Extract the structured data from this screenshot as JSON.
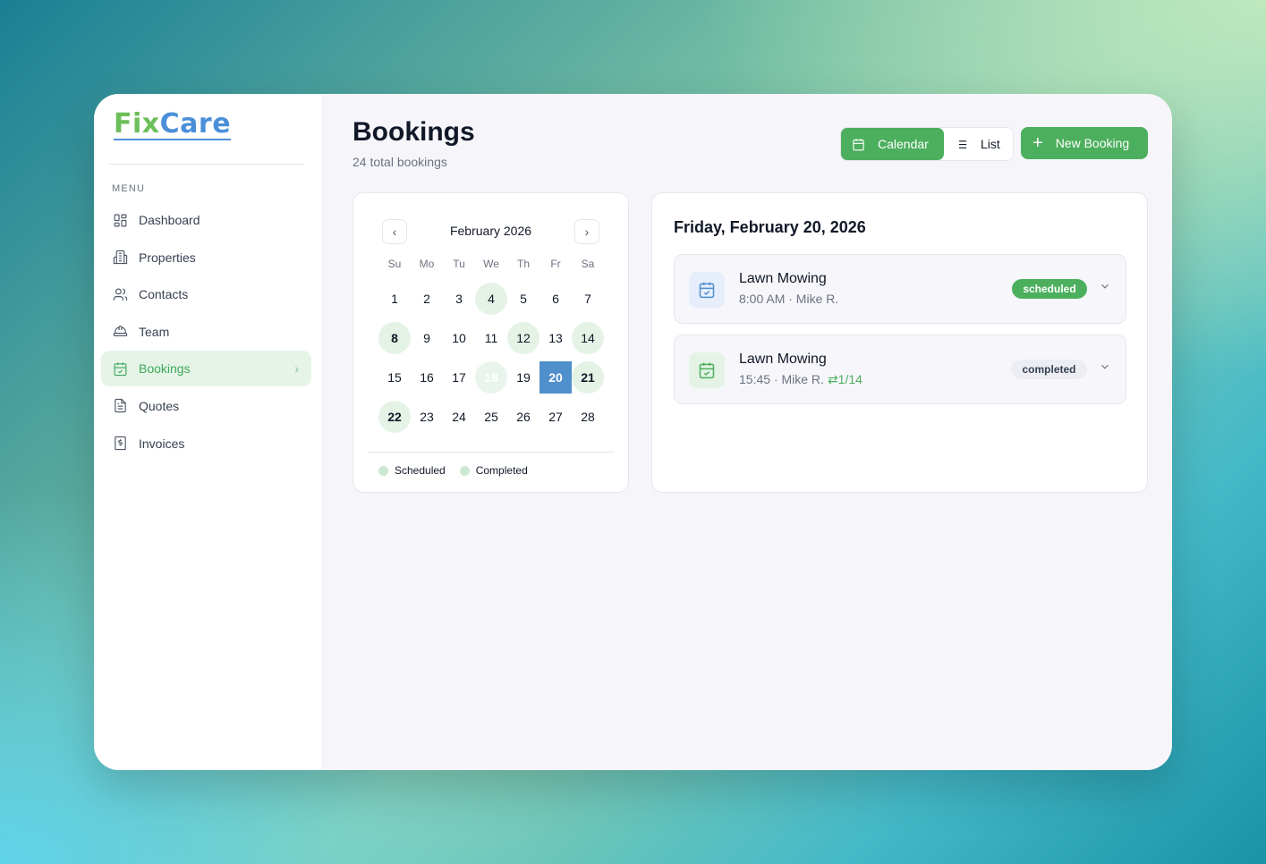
{
  "app": {
    "logo_fix": "Fix",
    "logo_care": "Care"
  },
  "sidebar": {
    "menu_label": "MENU",
    "items": [
      {
        "label": "Dashboard",
        "icon": "grid-icon"
      },
      {
        "label": "Properties",
        "icon": "building-icon"
      },
      {
        "label": "Contacts",
        "icon": "users-icon"
      },
      {
        "label": "Team",
        "icon": "hardhat-icon"
      },
      {
        "label": "Bookings",
        "icon": "calendar-check-icon",
        "active": true
      },
      {
        "label": "Quotes",
        "icon": "document-icon"
      },
      {
        "label": "Invoices",
        "icon": "invoice-icon"
      }
    ]
  },
  "header": {
    "title": "Bookings",
    "subtitle": "24 total bookings",
    "view_calendar": "Calendar",
    "view_list": "List",
    "new_booking": "New Booking"
  },
  "calendar": {
    "month": "February 2026",
    "weekdays": [
      "Su",
      "Mo",
      "Tu",
      "We",
      "Th",
      "Fr",
      "Sa"
    ],
    "days": [
      "1",
      "2",
      "3",
      "4",
      "5",
      "6",
      "7",
      "8",
      "9",
      "10",
      "11",
      "12",
      "13",
      "14",
      "15",
      "16",
      "17",
      "18",
      "19",
      "20",
      "21",
      "22",
      "23",
      "24",
      "25",
      "26",
      "27",
      "28"
    ],
    "selected_day": "20",
    "legend_scheduled": "Scheduled",
    "legend_completed": "Completed"
  },
  "day_panel": {
    "title": "Friday, February 20, 2026",
    "bookings": [
      {
        "name": "Lawn Mowing",
        "meta": "8:00 AM · Mike R.",
        "recur": "",
        "status": "scheduled"
      },
      {
        "name": "Lawn Mowing",
        "meta": "15:45 · Mike R.",
        "recur": "1/14",
        "status": "completed"
      }
    ]
  },
  "colors": {
    "accent_green": "#4caf5d",
    "selected_blue": "#4f8fcb",
    "logo_green": "#6cbf5a",
    "logo_blue": "#4b8fd9"
  }
}
